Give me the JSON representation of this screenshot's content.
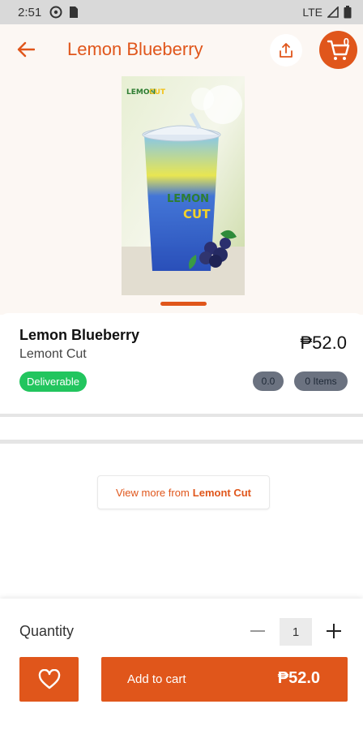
{
  "status_bar": {
    "time": "2:51",
    "network": "LTE"
  },
  "header": {
    "title": "Lemon Blueberry",
    "cart_count": "0"
  },
  "product": {
    "name": "Lemon Blueberry",
    "store": "Lemont Cut",
    "price": "₱52.0",
    "badge": "Deliverable",
    "rating": "0.0",
    "items": "0 Items",
    "image_logo_text": "Lemon Cut"
  },
  "view_more": {
    "prefix": "View more from",
    "store": "Lemont Cut"
  },
  "bottom": {
    "quantity_label": "Quantity",
    "quantity": "1",
    "add_to_cart": "Add to cart",
    "total": "₱52.0"
  },
  "colors": {
    "accent": "#e0561b",
    "badge_green": "#22c55e",
    "header_bg": "#fcf7f3"
  }
}
